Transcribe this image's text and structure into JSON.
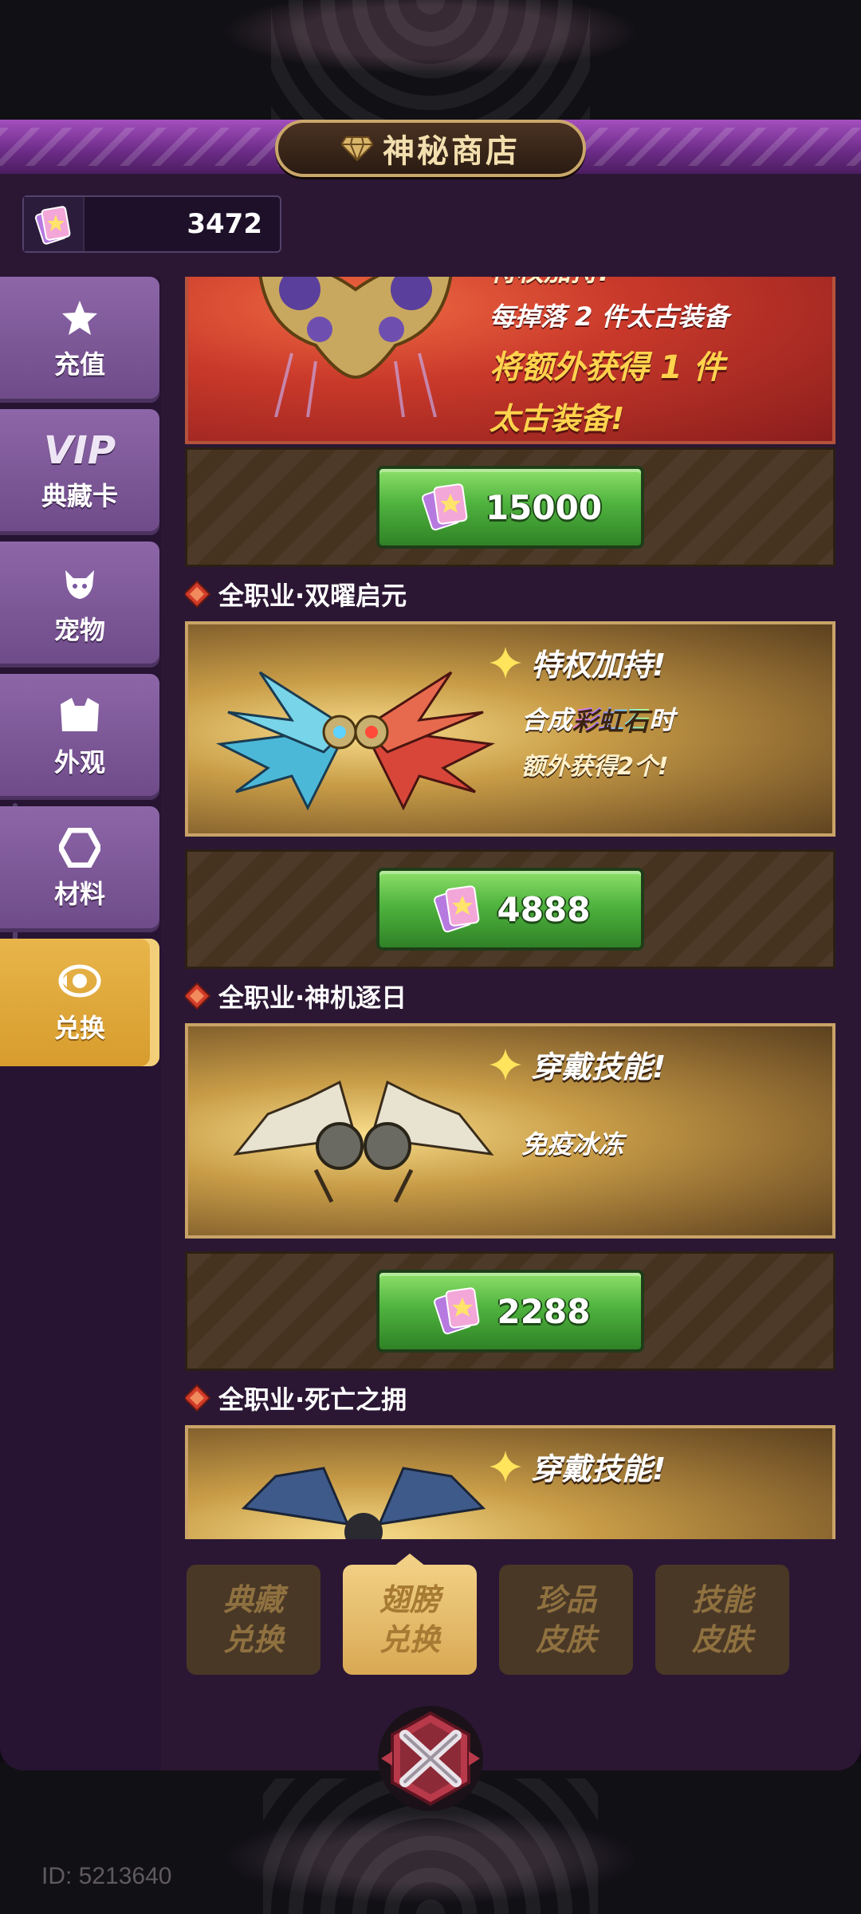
{
  "header": {
    "title": "神秘商店"
  },
  "currency": {
    "icon": "card-gem-icon",
    "value": "3472"
  },
  "sidebar": {
    "items": [
      {
        "label": "充值",
        "icon": "star-icon"
      },
      {
        "label": "VIP",
        "sub": "典藏卡"
      },
      {
        "label": "宠物",
        "icon": "pet-icon"
      },
      {
        "label": "外观",
        "icon": "armor-icon"
      },
      {
        "label": "材料",
        "icon": "hexagon-icon"
      },
      {
        "label": "兑换",
        "icon": "exchange-icon",
        "active": true
      }
    ]
  },
  "items": [
    {
      "perk_lines": [
        "特权加持!",
        "每掉落 2 件太古装备",
        "将额外获得 1 件",
        "太古装备!"
      ],
      "price": "15000"
    },
    {
      "name": "全职业·双曜启元",
      "perk_title": "特权加持!",
      "perk_line1_pre": "合成",
      "perk_line1_highlight": "彩虹石",
      "perk_line1_post": "时",
      "perk_line2": "额外获得2个!",
      "price": "4888"
    },
    {
      "name": "全职业·神机逐日",
      "perk_title": "穿戴技能!",
      "perk_line1": "免疫冰冻",
      "price": "2288"
    },
    {
      "name": "全职业·死亡之拥",
      "perk_title": "穿戴技能!"
    }
  ],
  "bottom_tabs": [
    {
      "label": "典藏\n兑换",
      "active": false
    },
    {
      "label": "翅膀\n兑换",
      "active": true
    },
    {
      "label": "珍品\n皮肤",
      "active": false
    },
    {
      "label": "技能\n皮肤",
      "active": false
    }
  ],
  "footer": {
    "id_text": "ID: 5213640"
  },
  "colors": {
    "accent_gold": "#e8b54a",
    "button_green": "#4fb33e",
    "panel_purple": "#2b1734"
  }
}
